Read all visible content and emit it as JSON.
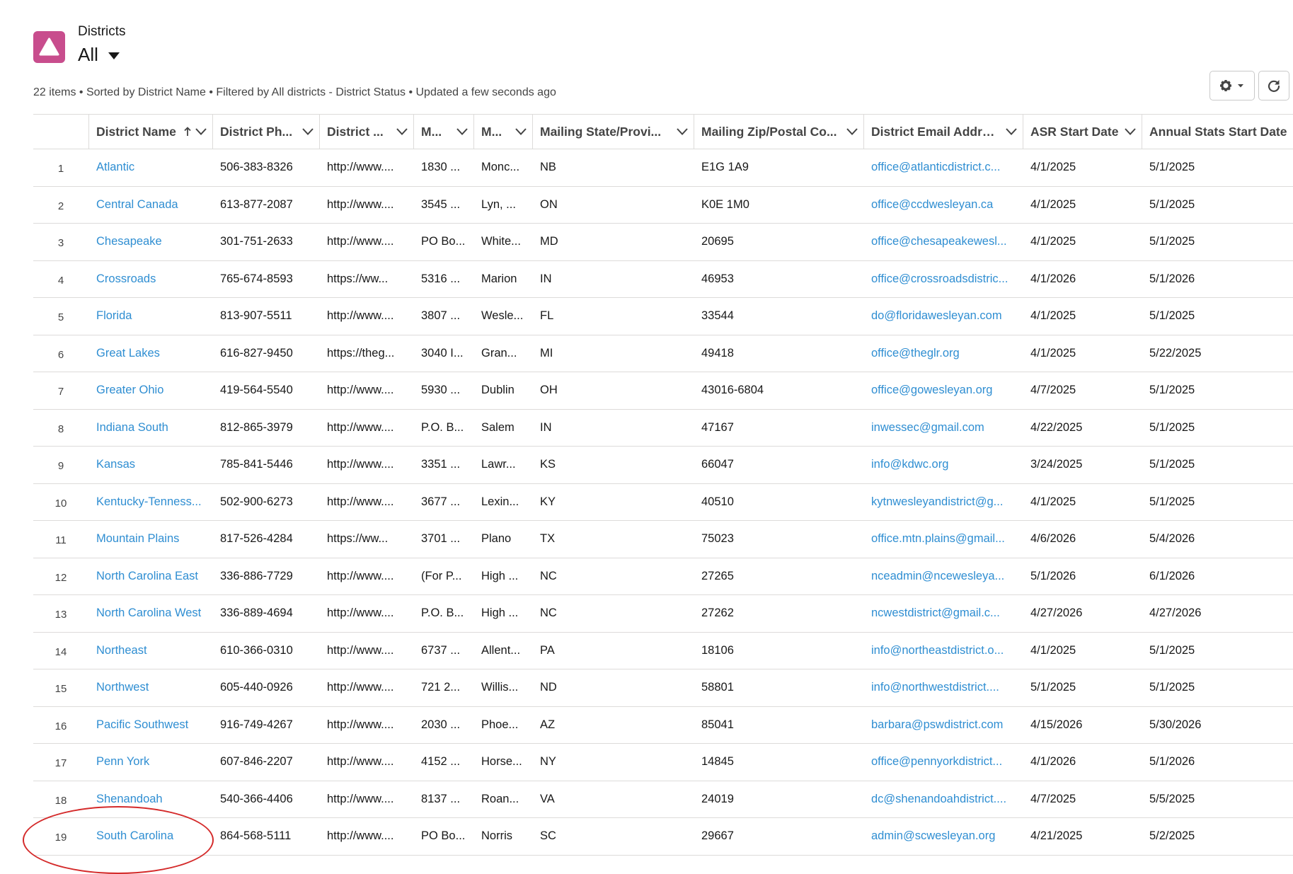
{
  "header": {
    "object_label": "Districts",
    "view_name": "All",
    "meta_text": "22 items • Sorted by District Name • Filtered by All districts - District Status • Updated a few seconds ago"
  },
  "table": {
    "columns": [
      {
        "label": "District Name",
        "sorted": "ascending"
      },
      {
        "label": "District Ph..."
      },
      {
        "label": "District ..."
      },
      {
        "label": "M..."
      },
      {
        "label": "M..."
      },
      {
        "label": "Mailing State/Provi..."
      },
      {
        "label": "Mailing Zip/Postal Co..."
      },
      {
        "label": "District Email Address"
      },
      {
        "label": "ASR Start Date"
      },
      {
        "label": "Annual Stats Start Date"
      }
    ],
    "rows": [
      {
        "num": "1",
        "name": "Atlantic",
        "phone": "506-383-8326",
        "website": "http://www....",
        "street": "1830 ...",
        "city": "Monc...",
        "state": "NB",
        "zip": "E1G 1A9",
        "email": "office@atlanticdistrict.c...",
        "asr": "4/1/2025",
        "annual": "5/1/2025"
      },
      {
        "num": "2",
        "name": "Central Canada",
        "phone": "613-877-2087",
        "website": "http://www....",
        "street": "3545 ...",
        "city": "Lyn, ...",
        "state": "ON",
        "zip": "K0E 1M0",
        "email": "office@ccdwesleyan.ca",
        "asr": "4/1/2025",
        "annual": "5/1/2025"
      },
      {
        "num": "3",
        "name": "Chesapeake",
        "phone": "301-751-2633",
        "website": "http://www....",
        "street": "PO Bo...",
        "city": "White...",
        "state": "MD",
        "zip": "20695",
        "email": "office@chesapeakewesl...",
        "asr": "4/1/2025",
        "annual": "5/1/2025"
      },
      {
        "num": "4",
        "name": "Crossroads",
        "phone": "765-674-8593",
        "website": "https://ww...",
        "street": "5316 ...",
        "city": "Marion",
        "state": "IN",
        "zip": "46953",
        "email": "office@crossroadsdistric...",
        "asr": "4/1/2026",
        "annual": "5/1/2026"
      },
      {
        "num": "5",
        "name": "Florida",
        "phone": "813-907-5511",
        "website": "http://www....",
        "street": "3807 ...",
        "city": "Wesle...",
        "state": "FL",
        "zip": "33544",
        "email": "do@floridawesleyan.com",
        "asr": "4/1/2025",
        "annual": "5/1/2025"
      },
      {
        "num": "6",
        "name": "Great Lakes",
        "phone": "616-827-9450",
        "website": "https://theg...",
        "street": "3040 I...",
        "city": "Gran...",
        "state": "MI",
        "zip": "49418",
        "email": "office@theglr.org",
        "asr": "4/1/2025",
        "annual": "5/22/2025"
      },
      {
        "num": "7",
        "name": "Greater Ohio",
        "phone": "419-564-5540",
        "website": "http://www....",
        "street": "5930 ...",
        "city": "Dublin",
        "state": "OH",
        "zip": "43016-6804",
        "email": "office@gowesleyan.org",
        "asr": "4/7/2025",
        "annual": "5/1/2025"
      },
      {
        "num": "8",
        "name": "Indiana South",
        "phone": "812-865-3979",
        "website": "http://www....",
        "street": "P.O. B...",
        "city": "Salem",
        "state": "IN",
        "zip": "47167",
        "email": "inwessec@gmail.com",
        "asr": "4/22/2025",
        "annual": "5/1/2025"
      },
      {
        "num": "9",
        "name": "Kansas",
        "phone": "785-841-5446",
        "website": "http://www....",
        "street": "3351 ...",
        "city": "Lawr...",
        "state": "KS",
        "zip": "66047",
        "email": "info@kdwc.org",
        "asr": "3/24/2025",
        "annual": "5/1/2025"
      },
      {
        "num": "10",
        "name": "Kentucky-Tenness...",
        "phone": "502-900-6273",
        "website": "http://www....",
        "street": "3677 ...",
        "city": "Lexin...",
        "state": "KY",
        "zip": "40510",
        "email": "kytnwesleyandistrict@g...",
        "asr": "4/1/2025",
        "annual": "5/1/2025"
      },
      {
        "num": "11",
        "name": "Mountain Plains",
        "phone": "817-526-4284",
        "website": "https://ww...",
        "street": "3701 ...",
        "city": "Plano",
        "state": "TX",
        "zip": "75023",
        "email": "office.mtn.plains@gmail...",
        "asr": "4/6/2026",
        "annual": "5/4/2026"
      },
      {
        "num": "12",
        "name": "North Carolina East",
        "phone": "336-886-7729",
        "website": "http://www....",
        "street": "(For P...",
        "city": "High ...",
        "state": "NC",
        "zip": "27265",
        "email": "nceadmin@ncewesleya...",
        "asr": "5/1/2026",
        "annual": "6/1/2026"
      },
      {
        "num": "13",
        "name": "North Carolina West",
        "phone": "336-889-4694",
        "website": "http://www....",
        "street": "P.O. B...",
        "city": "High ...",
        "state": "NC",
        "zip": "27262",
        "email": "ncwestdistrict@gmail.c...",
        "asr": "4/27/2026",
        "annual": "4/27/2026"
      },
      {
        "num": "14",
        "name": "Northeast",
        "phone": "610-366-0310",
        "website": "http://www....",
        "street": "6737 ...",
        "city": "Allent...",
        "state": "PA",
        "zip": "18106",
        "email": "info@northeastdistrict.o...",
        "asr": "4/1/2025",
        "annual": "5/1/2025"
      },
      {
        "num": "15",
        "name": "Northwest",
        "phone": "605-440-0926",
        "website": "http://www....",
        "street": "721 2...",
        "city": "Willis...",
        "state": "ND",
        "zip": "58801",
        "email": "info@northwestdistrict....",
        "asr": "5/1/2025",
        "annual": "5/1/2025"
      },
      {
        "num": "16",
        "name": "Pacific Southwest",
        "phone": "916-749-4267",
        "website": "http://www....",
        "street": "2030 ...",
        "city": "Phoe...",
        "state": "AZ",
        "zip": "85041",
        "email": "barbara@pswdistrict.com",
        "asr": "4/15/2026",
        "annual": "5/30/2026"
      },
      {
        "num": "17",
        "name": "Penn York",
        "phone": "607-846-2207",
        "website": "http://www....",
        "street": "4152 ...",
        "city": "Horse...",
        "state": "NY",
        "zip": "14845",
        "email": "office@pennyorkdistrict...",
        "asr": "4/1/2026",
        "annual": "5/1/2026"
      },
      {
        "num": "18",
        "name": "Shenandoah",
        "phone": "540-366-4406",
        "website": "http://www....",
        "street": "8137 ...",
        "city": "Roan...",
        "state": "VA",
        "zip": "24019",
        "email": "dc@shenandoahdistrict....",
        "asr": "4/7/2025",
        "annual": "5/5/2025"
      },
      {
        "num": "19",
        "name": "South Carolina",
        "phone": "864-568-5111",
        "website": "http://www....",
        "street": "PO Bo...",
        "city": "Norris",
        "state": "SC",
        "zip": "29667",
        "email": "admin@scwesleyan.org",
        "asr": "4/21/2025",
        "annual": "5/2/2025"
      }
    ]
  },
  "colors": {
    "app_icon": "#c84d8d",
    "link": "#2f8ed2",
    "highlight_circle": "#d42a2a"
  },
  "icons": {
    "app": "triangle-icon",
    "view_switcher": "caret-down-icon",
    "settings": "gear-icon",
    "refresh": "refresh-icon"
  }
}
